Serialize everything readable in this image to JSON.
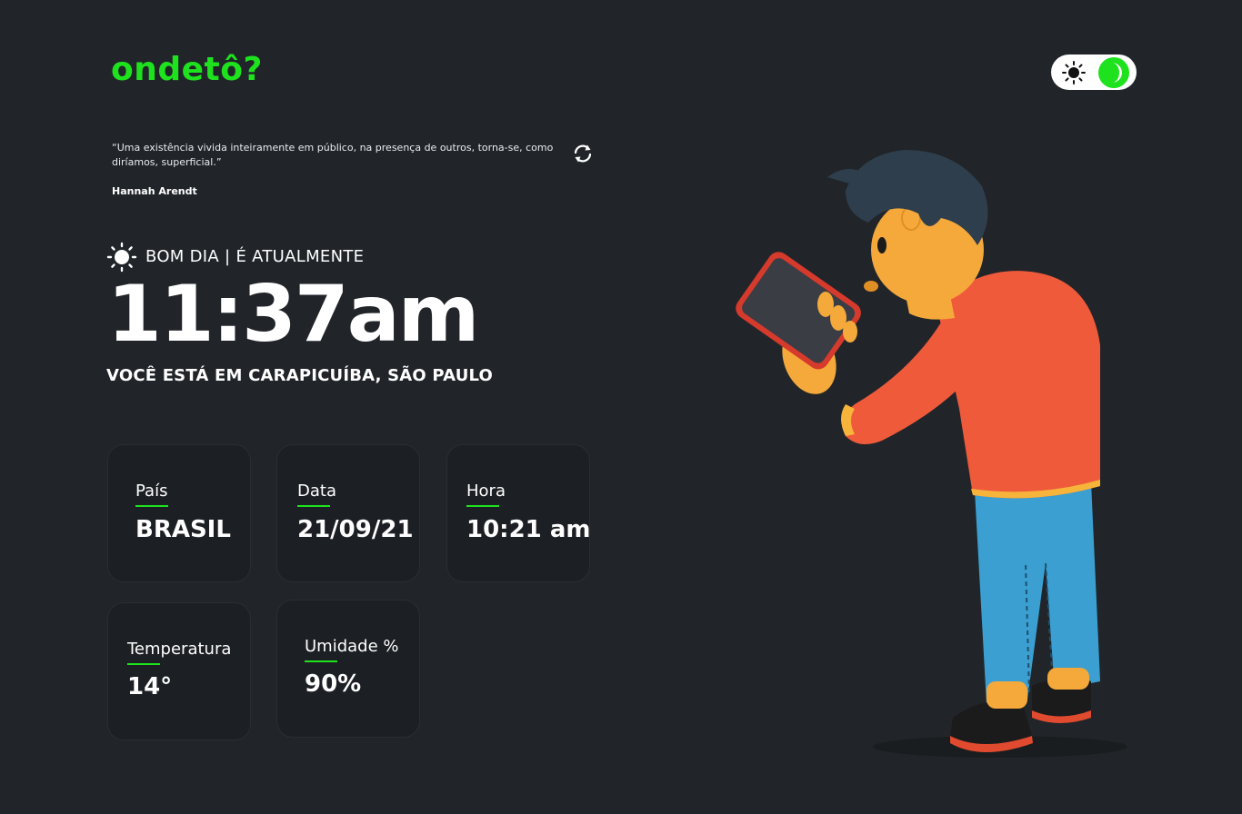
{
  "header": {
    "logo": "ondetô?",
    "theme_toggle": {
      "left_icon": "sun-icon",
      "right_icon": "moon-icon",
      "accent": "#1ee21e"
    }
  },
  "quote": {
    "text": "“Uma existência vivida inteiramente em público, na presença de outros, torna-se, como diríamos, superficial.”",
    "author": "Hannah Arendt",
    "refresh_icon": "refresh-icon"
  },
  "greeting": {
    "icon": "sun-icon",
    "text": "BOM DIA | É ATUALMENTE",
    "time": "11:37am",
    "location": "VOCÊ ESTÁ EM CARAPICUÍBA, SÃO PAULO"
  },
  "cards": [
    {
      "label": "País",
      "value": "BRASIL"
    },
    {
      "label": "Data",
      "value": "21/09/21"
    },
    {
      "label": "Hora",
      "value": "10:21 am"
    },
    {
      "label": "Temperatura",
      "value": "14°"
    },
    {
      "label": "Umidade %",
      "value": "90%"
    }
  ],
  "colors": {
    "background": "#212529",
    "card": "#1c1f23",
    "accent": "#1ee21e",
    "text": "#ffffff"
  }
}
